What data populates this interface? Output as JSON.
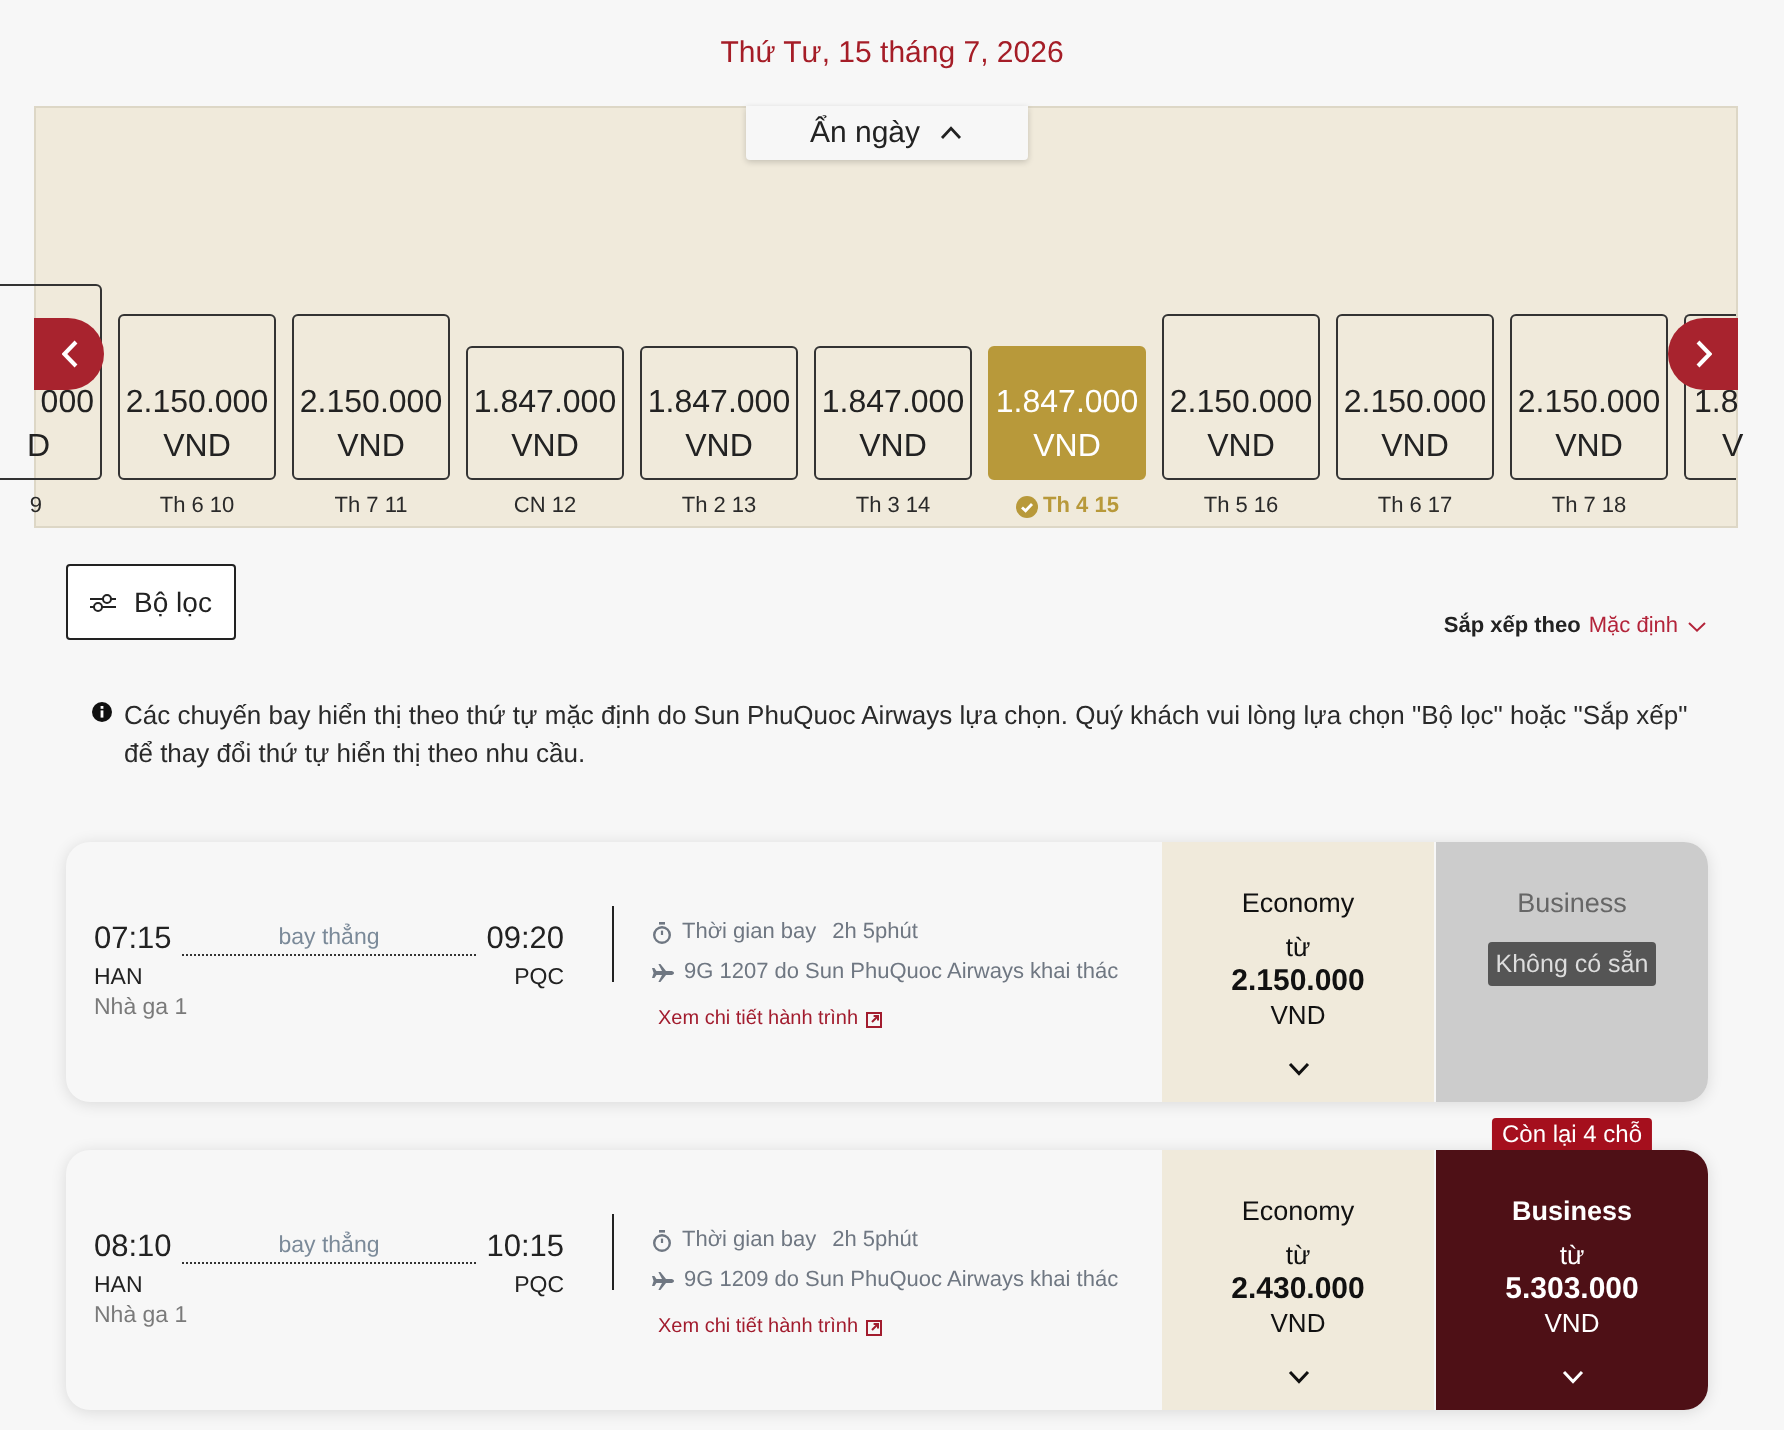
{
  "date_heading": "Thứ Tư, 15 tháng 7, 2026",
  "date_strip": {
    "toggle_label": "Ẩn ngày",
    "expanded": true,
    "days": [
      {
        "kind": "tall",
        "price": "000",
        "currency": "D",
        "label": "9",
        "selected": false,
        "clipped_left": true,
        "clipped_right": false
      },
      {
        "kind": "medium",
        "price": "2.150.000",
        "currency": "VND",
        "label": "Th 6 10",
        "selected": false,
        "clipped_left": false,
        "clipped_right": false
      },
      {
        "kind": "medium",
        "price": "2.150.000",
        "currency": "VND",
        "label": "Th 7 11",
        "selected": false,
        "clipped_left": false,
        "clipped_right": false
      },
      {
        "kind": "short",
        "price": "1.847.000",
        "currency": "VND",
        "label": "CN 12",
        "selected": false,
        "clipped_left": false,
        "clipped_right": false
      },
      {
        "kind": "short",
        "price": "1.847.000",
        "currency": "VND",
        "label": "Th 2 13",
        "selected": false,
        "clipped_left": false,
        "clipped_right": false
      },
      {
        "kind": "short",
        "price": "1.847.000",
        "currency": "VND",
        "label": "Th 3 14",
        "selected": false,
        "clipped_left": false,
        "clipped_right": false
      },
      {
        "kind": "short",
        "price": "1.847.000",
        "currency": "VND",
        "label": "Th 4 15",
        "selected": true,
        "clipped_left": false,
        "clipped_right": false
      },
      {
        "kind": "medium",
        "price": "2.150.000",
        "currency": "VND",
        "label": "Th 5 16",
        "selected": false,
        "clipped_left": false,
        "clipped_right": false
      },
      {
        "kind": "medium",
        "price": "2.150.000",
        "currency": "VND",
        "label": "Th 6 17",
        "selected": false,
        "clipped_left": false,
        "clipped_right": false
      },
      {
        "kind": "medium",
        "price": "2.150.000",
        "currency": "VND",
        "label": "Th 7 18",
        "selected": false,
        "clipped_left": false,
        "clipped_right": false
      },
      {
        "kind": "medium",
        "price": "1.8",
        "currency": "V",
        "selected": false,
        "clipped_left": false,
        "clipped_right": true
      }
    ]
  },
  "filter": {
    "label": "Bộ lọc"
  },
  "sort": {
    "label": "Sắp xếp theo",
    "value": "Mặc định"
  },
  "notice": "Các chuyến bay hiển thị theo thứ tự mặc định do Sun PhuQuoc Airways lựa chọn. Quý khách vui lòng lựa chọn \"Bộ lọc\" hoặc \"Sắp xếp\" để thay đổi thứ tự hiển thị theo nhu cầu.",
  "flights": [
    {
      "depart_time": "07:15",
      "arrive_time": "09:20",
      "stop_label": "bay thẳng",
      "origin": "HAN",
      "destination": "PQC",
      "terminal": "Nhà ga 1",
      "duration_label": "Thời gian bay",
      "duration": "2h 5phút",
      "flight_info": "9G 1207 do Sun PhuQuoc Airways khai thác",
      "details_link": "Xem chi tiết hành trình",
      "fares": [
        {
          "kind": "economy",
          "name": "Economy",
          "available": true,
          "from_label": "từ",
          "price": "2.150.000",
          "currency": "VND"
        },
        {
          "kind": "business",
          "name": "Business",
          "available": false,
          "status": "Không có sẵn"
        }
      ]
    },
    {
      "depart_time": "08:10",
      "arrive_time": "10:15",
      "stop_label": "bay thẳng",
      "origin": "HAN",
      "destination": "PQC",
      "terminal": "Nhà ga 1",
      "duration_label": "Thời gian bay",
      "duration": "2h 5phút",
      "flight_info": "9G 1209 do Sun PhuQuoc Airways khai thác",
      "details_link": "Xem chi tiết hành trình",
      "fares": [
        {
          "kind": "economy",
          "name": "Economy",
          "available": true,
          "from_label": "từ",
          "price": "2.430.000",
          "currency": "VND"
        },
        {
          "kind": "business",
          "name": "Business",
          "available": true,
          "from_label": "từ",
          "price": "5.303.000",
          "currency": "VND",
          "seats_badge": "Còn lại 4 chỗ"
        }
      ]
    }
  ]
}
